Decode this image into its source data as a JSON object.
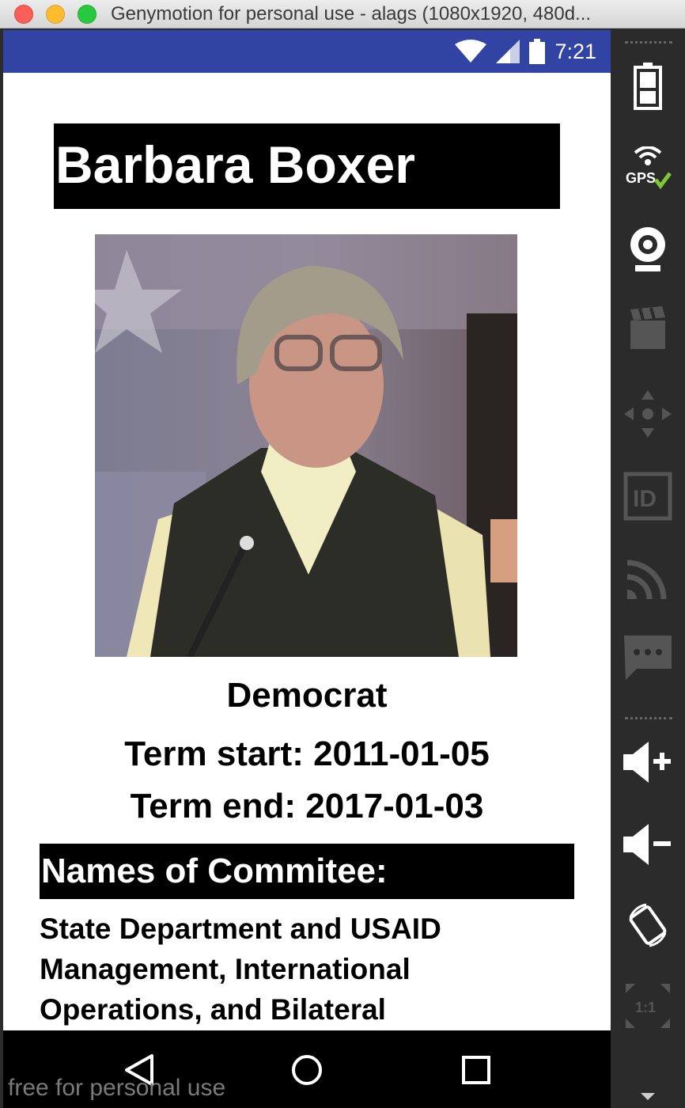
{
  "window": {
    "title": "Genymotion for personal use - alags (1080x1920, 480d..."
  },
  "status_bar": {
    "time": "7:21",
    "color": "#3143a3"
  },
  "senator": {
    "name": "Barbara Boxer",
    "party": "Democrat",
    "term_start": "Term start: 2011-01-05",
    "term_end": "Term end: 2017-01-03"
  },
  "committee": {
    "heading": "Names of Commitee:",
    "text": "State Department and USAID Management, International Operations, and Bilateral"
  },
  "watermark": "free for personal use",
  "sidebar": {
    "gps_label": "GPS",
    "id_label": "ID",
    "scale_label": "1:1"
  },
  "icons": {
    "status": [
      "wifi-icon",
      "signal-icon",
      "battery-icon"
    ],
    "nav": [
      "back-icon",
      "home-icon",
      "recents-icon"
    ],
    "sidebar": [
      "battery-icon",
      "gps-icon",
      "webcam-icon",
      "camera-icon",
      "dpad-icon",
      "id-icon",
      "cast-icon",
      "sms-icon",
      "volume-up-icon",
      "volume-down-icon",
      "rotate-icon",
      "scale-icon"
    ]
  }
}
